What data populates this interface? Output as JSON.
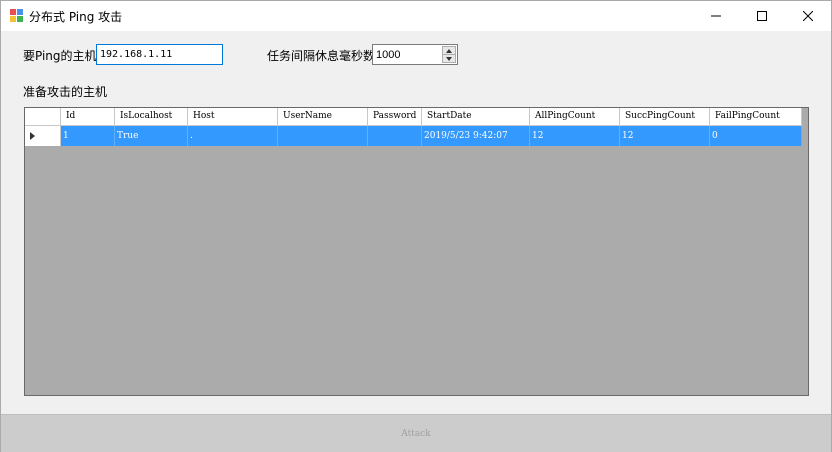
{
  "window": {
    "title": "分布式 Ping 攻击"
  },
  "form": {
    "host_label": "要Ping的主机",
    "host_value": "192.168.1.11",
    "interval_label": "任务间隔休息毫秒数",
    "interval_value": "1000",
    "section_label": "准备攻击的主机"
  },
  "grid": {
    "columns": [
      "Id",
      "IsLocalhost",
      "Host",
      "UserName",
      "Password",
      "StartDate",
      "AllPingCount",
      "SuccPingCount",
      "FailPingCount"
    ],
    "rows": [
      [
        "1",
        "True",
        ".",
        "",
        "",
        "2019/5/23 9:42:07",
        "12",
        "12",
        "0"
      ]
    ]
  },
  "footer": {
    "attack_label": "Attack"
  },
  "colors": {
    "selection": "#3399ff",
    "grid_background": "#ababab",
    "focus_border": "#0078d7"
  },
  "icons": {
    "app": "app-icon",
    "minimize": "minimize-icon",
    "maximize": "maximize-icon",
    "close": "close-icon",
    "row_pointer": "row-pointer-icon"
  }
}
